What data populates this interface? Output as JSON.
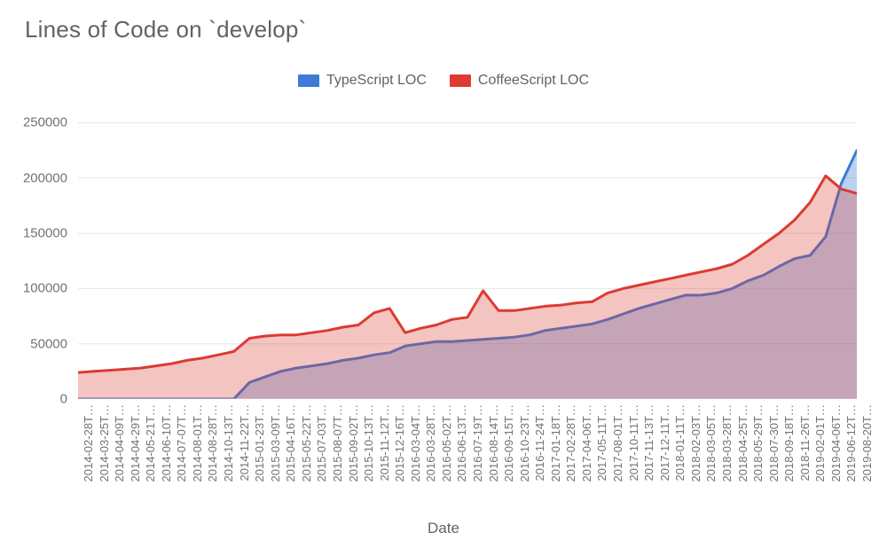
{
  "title": "Lines of Code on `develop`",
  "xlabel": "Date",
  "legend": {
    "ts": {
      "label": "TypeScript LOC",
      "color": "#3e7ad6"
    },
    "cs": {
      "label": "CoffeeScript LOC",
      "color": "#dc3a32"
    }
  },
  "y_axis": {
    "min": 0,
    "max": 260000,
    "ticks": [
      0,
      50000,
      100000,
      150000,
      200000,
      250000
    ],
    "tick_labels": [
      "0",
      "50000",
      "100000",
      "150000",
      "200000",
      "250000"
    ]
  },
  "x_axis": {
    "tick_labels": [
      "2014-02-28T…",
      "2014-03-25T…",
      "2014-04-09T…",
      "2014-04-29T…",
      "2014-05-21T…",
      "2014-06-10T…",
      "2014-07-07T…",
      "2014-08-01T…",
      "2014-08-28T…",
      "2014-10-13T…",
      "2014-11-22T…",
      "2015-01-23T…",
      "2015-03-09T…",
      "2015-04-16T…",
      "2015-05-22T…",
      "2015-07-03T…",
      "2015-08-07T…",
      "2015-09-02T…",
      "2015-10-13T…",
      "2015-11-12T…",
      "2015-12-16T…",
      "2016-03-04T…",
      "2016-03-28T…",
      "2016-05-02T…",
      "2016-06-13T…",
      "2016-07-19T…",
      "2016-08-14T…",
      "2016-09-15T…",
      "2016-10-23T…",
      "2016-11-24T…",
      "2017-01-18T…",
      "2017-02-28T…",
      "2017-04-06T…",
      "2017-05-11T…",
      "2017-08-01T…",
      "2017-10-11T…",
      "2017-11-13T…",
      "2017-12-11T…",
      "2018-01-11T…",
      "2018-02-03T…",
      "2018-03-05T…",
      "2018-03-28T…",
      "2018-04-25T…",
      "2018-05-29T…",
      "2018-07-30T…",
      "2018-09-18T…",
      "2018-11-26T…",
      "2019-02-01T…",
      "2019-04-06T…",
      "2019-06-12T…",
      "2019-08-20T…"
    ]
  },
  "chart_data": {
    "type": "area",
    "title": "Lines of Code on `develop`",
    "xlabel": "Date",
    "ylabel": "",
    "ylim": [
      0,
      260000
    ],
    "categories": [
      "2014-02-28",
      "2014-03-25",
      "2014-04-09",
      "2014-04-29",
      "2014-05-21",
      "2014-06-10",
      "2014-07-07",
      "2014-08-01",
      "2014-08-28",
      "2014-10-13",
      "2014-11-22",
      "2015-01-23",
      "2015-03-09",
      "2015-04-16",
      "2015-05-22",
      "2015-07-03",
      "2015-08-07",
      "2015-09-02",
      "2015-10-13",
      "2015-11-12",
      "2015-12-16",
      "2016-03-04",
      "2016-03-28",
      "2016-05-02",
      "2016-06-13",
      "2016-07-19",
      "2016-08-14",
      "2016-09-15",
      "2016-10-23",
      "2016-11-24",
      "2017-01-18",
      "2017-02-28",
      "2017-04-06",
      "2017-05-11",
      "2017-08-01",
      "2017-10-11",
      "2017-11-13",
      "2017-12-11",
      "2018-01-11",
      "2018-02-03",
      "2018-03-05",
      "2018-03-28",
      "2018-04-25",
      "2018-05-29",
      "2018-07-30",
      "2018-09-18",
      "2018-11-26",
      "2019-02-01",
      "2019-04-06",
      "2019-06-12",
      "2019-08-20"
    ],
    "series": [
      {
        "name": "TypeScript LOC",
        "color": "#3e7ad6",
        "fill": "rgba(62,122,214,0.35)",
        "values": [
          0,
          0,
          0,
          0,
          0,
          0,
          0,
          0,
          0,
          0,
          0,
          15000,
          20000,
          25000,
          28000,
          30000,
          32000,
          35000,
          37000,
          40000,
          42000,
          48000,
          50000,
          52000,
          52000,
          53000,
          54000,
          55000,
          56000,
          58000,
          62000,
          64000,
          66000,
          68000,
          72000,
          77000,
          82000,
          86000,
          90000,
          94000,
          94000,
          96000,
          100000,
          107000,
          112000,
          120000,
          127000,
          130000,
          147000,
          195000,
          225000
        ]
      },
      {
        "name": "CoffeeScript LOC",
        "color": "#dc3a32",
        "fill": "rgba(220,58,50,0.30)",
        "values": [
          24000,
          25000,
          26000,
          27000,
          28000,
          30000,
          32000,
          35000,
          37000,
          40000,
          43000,
          55000,
          57000,
          58000,
          58000,
          60000,
          62000,
          65000,
          67000,
          78000,
          82000,
          60000,
          64000,
          67000,
          72000,
          74000,
          98000,
          80000,
          80000,
          82000,
          84000,
          85000,
          87000,
          88000,
          96000,
          100000,
          103000,
          106000,
          109000,
          112000,
          115000,
          118000,
          122000,
          130000,
          140000,
          150000,
          162000,
          178000,
          202000,
          190000,
          186000
        ]
      }
    ]
  }
}
